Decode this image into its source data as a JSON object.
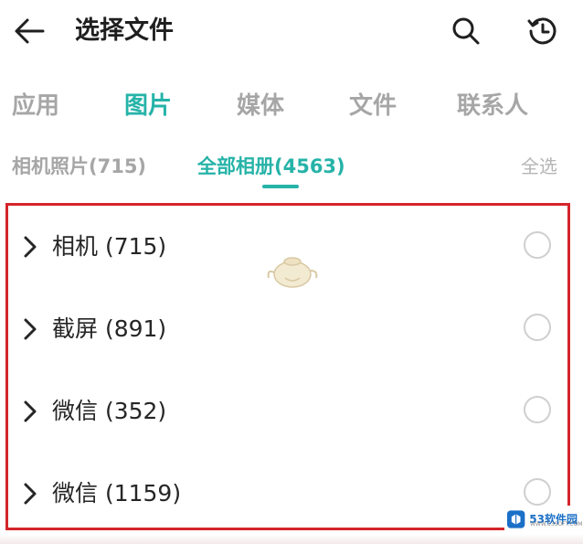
{
  "header": {
    "title": "选择文件",
    "back_icon": "arrow-left-icon",
    "search_icon": "search-icon",
    "history_icon": "history-clock-icon"
  },
  "tabs": [
    {
      "label": "应用",
      "active": false
    },
    {
      "label": "图片",
      "active": true
    },
    {
      "label": "媒体",
      "active": false
    },
    {
      "label": "文件",
      "active": false
    },
    {
      "label": "联系人",
      "active": false
    }
  ],
  "subtabs": [
    {
      "label": "相机照片(715)",
      "active": false
    },
    {
      "label": "全部相册(4563)",
      "active": true
    }
  ],
  "select_all": "全选",
  "albums": [
    {
      "label": "相机 (715)",
      "selected": false
    },
    {
      "label": "截屏 (891)",
      "selected": false
    },
    {
      "label": "微信 (352)",
      "selected": false
    },
    {
      "label": "微信 (1159)",
      "selected": false
    }
  ],
  "brand": {
    "name": "53软件园",
    "sub": "WWW.53SOFT.COM"
  },
  "colors": {
    "accent": "#26b3a8",
    "highlight_frame": "#d4252b",
    "inactive_text": "#a6a6a6"
  }
}
